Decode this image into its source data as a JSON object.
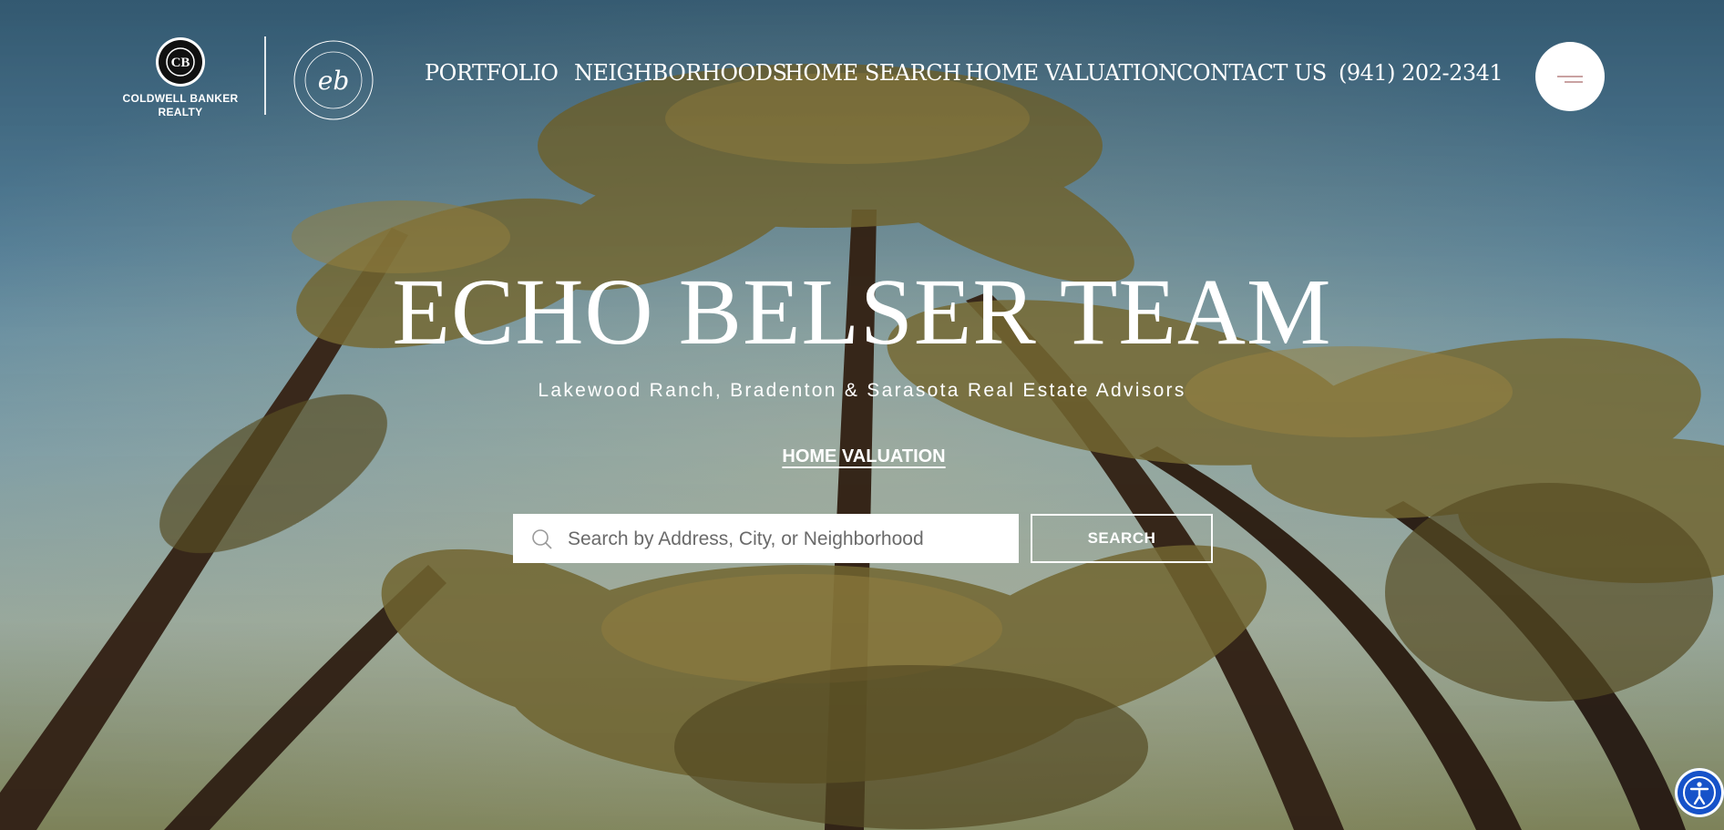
{
  "header": {
    "brokerage_logo": {
      "line1": "COLDWELL BANKER",
      "line2": "REALTY"
    },
    "team_logo": "ECHO BELSER TEAM",
    "nav": [
      {
        "label": "PORTFOLIO"
      },
      {
        "label": "NEIGHBORHOODS"
      },
      {
        "label": "HOME SEARCH"
      },
      {
        "label": "HOME VALUATION"
      },
      {
        "label": "CONTACT US"
      },
      {
        "label": "(941) 202-2341"
      }
    ],
    "menu_icon": "hamburger-icon"
  },
  "hero": {
    "title": "ECHO BELSER TEAM",
    "subtitle": "Lakewood Ranch, Bradenton & Sarasota Real Estate Advisors",
    "link": "HOME VALUATION",
    "search": {
      "placeholder": "Search by Address, City, or Neighborhood",
      "value": "",
      "button": "SEARCH",
      "icon": "search-icon"
    }
  },
  "accessibility": {
    "icon": "accessibility-icon"
  },
  "colors": {
    "sky_top": "#3f6d8a",
    "palm_trunk": "#4a3424",
    "frond": "#8a7a3a",
    "menu_line": "#c9a2a2",
    "accessibility_blue": "#1652c9"
  }
}
